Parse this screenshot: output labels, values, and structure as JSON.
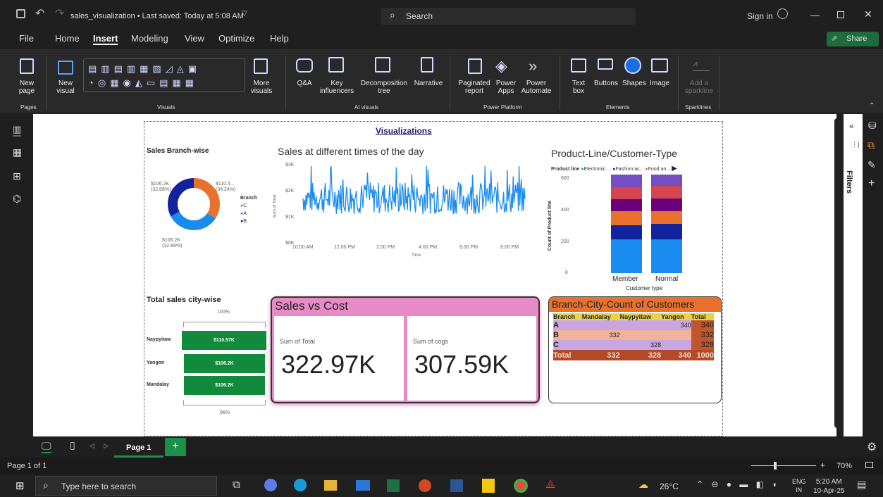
{
  "titlebar": {
    "file_title": "sales_visualization • Last saved: Today at 5:08 AM",
    "search": "Search",
    "sign_in": "Sign in"
  },
  "menu": [
    "File",
    "Home",
    "Insert",
    "Modeling",
    "View",
    "Optimize",
    "Help"
  ],
  "share": "Share",
  "ribbon": {
    "new_page": "New page",
    "new_visual": "New visual",
    "more_visuals": "More visuals",
    "qa": "Q&A",
    "key_influencers": "Key influencers",
    "decomposition_tree": "Decomposition tree",
    "narrative": "Narrative",
    "paginated_report": "Paginated report",
    "power_apps": "Power Apps",
    "power_automate": "Power Automate",
    "text_box": "Text box",
    "buttons": "Buttons",
    "shapes": "Shapes",
    "image": "Image",
    "add_sparkline": "Add a sparkline",
    "groups": {
      "pages": "Pages",
      "visuals": "Visuals",
      "ai": "AI visuals",
      "power_platform": "Power Platform",
      "elements": "Elements",
      "sparklines": "Sparklines"
    }
  },
  "report": {
    "title": "Visualizations",
    "donut": {
      "title": "Sales Branch-wise",
      "label_a": "$106.2K",
      "pct_a": "(32.88%)",
      "label_c": "$110.5...",
      "pct_c": "(34.24%)",
      "label_b": "$106.2K",
      "pct_b": "(32.88%)",
      "legend_title": "Branch",
      "legend": [
        "C",
        "A",
        "B"
      ],
      "colors": [
        "#e8712d",
        "#1a8cf0",
        "#12239e"
      ]
    },
    "line": {
      "title": "Sales at different times of the day",
      "ylabel": "Sum of Total",
      "xlabel": "Time",
      "yticks": [
        "$3K",
        "$2K",
        "$1K",
        "$0K"
      ],
      "xticks": [
        "10:00 AM",
        "12:00 PM",
        "2:00 PM",
        "4:00 PM",
        "6:00 PM",
        "8:00 PM"
      ],
      "color": "#1a8cf0"
    },
    "stacked": {
      "title": "Product-Line/Customer-Type",
      "legend_title": "Product line",
      "legend": [
        "Electronic ...",
        "Fashion ac...",
        "Food an..."
      ],
      "legend_colors": [
        "#1a8cf0",
        "#12239e",
        "#e8712d"
      ],
      "ylabel": "Count of Product line",
      "xlabel": "Customer type",
      "yticks": [
        "600",
        "400",
        "200",
        "0"
      ],
      "categories": [
        "Member",
        "Normal"
      ]
    },
    "city": {
      "title": "Total sales city-wise",
      "top_pct": "100%",
      "bottom_pct": "96%",
      "rows": [
        {
          "city": "Naypyitaw",
          "value": "$110.57K"
        },
        {
          "city": "Yangon",
          "value": "$106.2K"
        },
        {
          "city": "Mandalay",
          "value": "$106.2K"
        }
      ]
    },
    "cards": {
      "title": "Sales vs Cost",
      "total_label": "Sum of Total",
      "total_value": "322.97K",
      "cogs_label": "Sum of cogs",
      "cogs_value": "307.59K"
    },
    "matrix": {
      "title": "Branch-City-Count of Customers",
      "headers": [
        "Branch",
        "Mandalay",
        "Naypyitaw",
        "Yangon",
        "Total"
      ],
      "rows": [
        [
          "A",
          "",
          "",
          "340",
          "340"
        ],
        [
          "B",
          "332",
          "",
          "",
          "332"
        ],
        [
          "C",
          "",
          "328",
          "",
          "328"
        ],
        [
          "Total",
          "332",
          "328",
          "340",
          "1000"
        ]
      ]
    }
  },
  "filters": "Filters",
  "page_tab": "Page 1",
  "status": {
    "page": "Page 1 of 1",
    "zoom": "70%"
  },
  "taskbar": {
    "search": "Type here to search",
    "temp": "26°C",
    "lang": "ENG",
    "region": "IN",
    "time": "5:20 AM",
    "date": "10-Apr-25"
  }
}
